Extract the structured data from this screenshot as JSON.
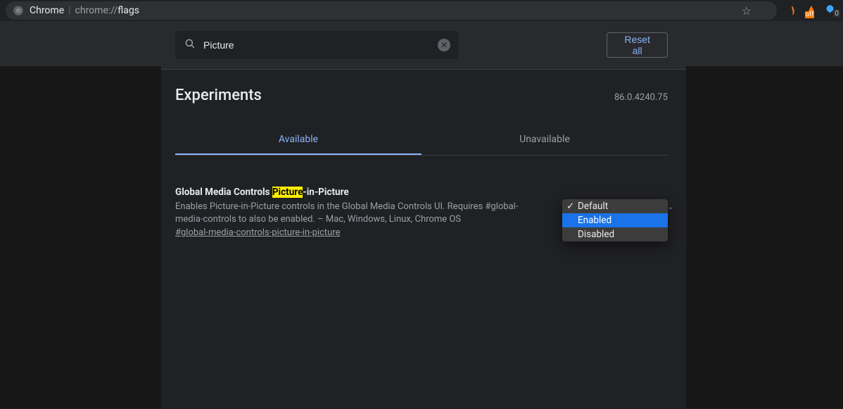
{
  "addressbar": {
    "browser_label": "Chrome",
    "url_scheme": "chrome://",
    "url_path": "flags",
    "ext_off_badge": "off",
    "ext_msg_badge": "0"
  },
  "header": {
    "search_value": "Picture",
    "reset_label": "Reset all"
  },
  "page": {
    "title": "Experiments",
    "version": "86.0.4240.75"
  },
  "tabs": {
    "available": "Available",
    "unavailable": "Unavailable"
  },
  "flag": {
    "title_prefix": "Global Media Controls ",
    "title_highlight": "Picture",
    "title_suffix": "-in-Picture",
    "description": "Enables Picture-in-Picture controls in the Global Media Controls UI. Requires #global-media-controls to also be enabled. – Mac, Windows, Linux, Chrome OS",
    "hash": "#global-media-controls-picture-in-picture"
  },
  "dropdown": {
    "options": [
      "Default",
      "Enabled",
      "Disabled"
    ],
    "selected": "Default",
    "highlighted": "Enabled"
  }
}
